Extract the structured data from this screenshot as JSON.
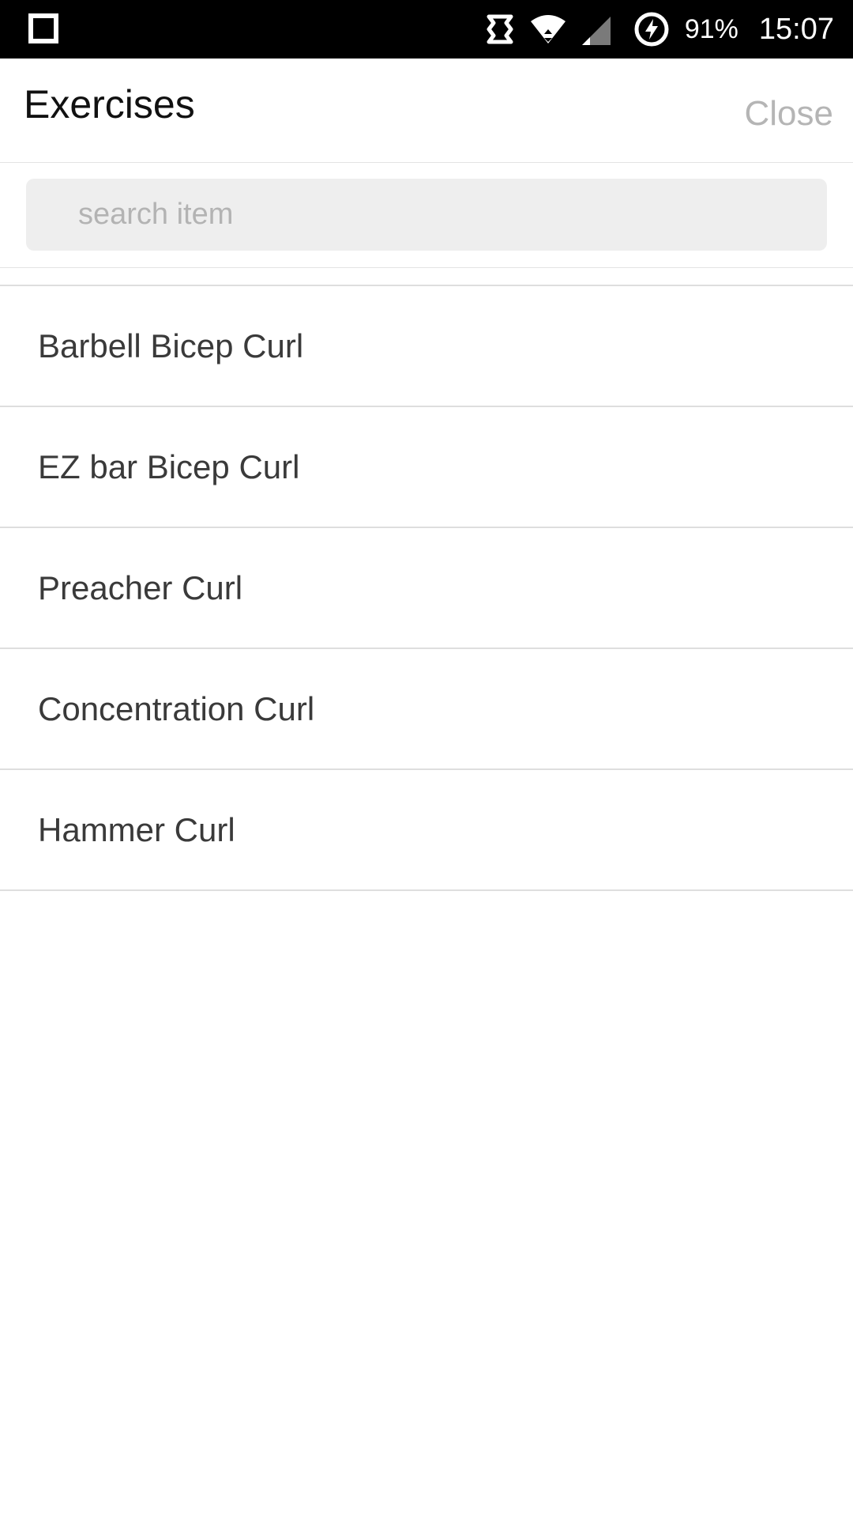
{
  "status_bar": {
    "battery_percent": "91%",
    "time": "15:07",
    "icons": [
      "square-notification-icon",
      "data-transfer-icon",
      "wifi-icon",
      "cellular-signal-icon",
      "battery-charging-icon"
    ]
  },
  "header": {
    "title": "Exercises",
    "close_label": "Close"
  },
  "search": {
    "placeholder": "search item",
    "value": ""
  },
  "exercises": [
    {
      "label": "Barbell Bicep Curl"
    },
    {
      "label": "EZ bar Bicep Curl"
    },
    {
      "label": "Preacher Curl"
    },
    {
      "label": "Concentration Curl"
    },
    {
      "label": "Hammer Curl"
    }
  ]
}
